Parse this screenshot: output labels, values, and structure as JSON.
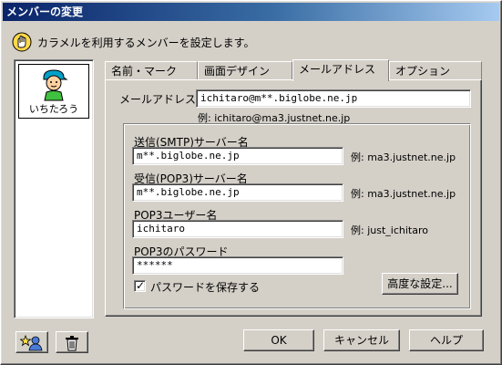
{
  "window": {
    "title": "メンバーの変更"
  },
  "intro": {
    "text": "カラメルを利用するメンバーを設定します。"
  },
  "members": [
    {
      "name": "いちたろう"
    }
  ],
  "tabs": [
    {
      "label": "名前・マーク"
    },
    {
      "label": "画面デザイン"
    },
    {
      "label": "メールアドレス",
      "active": true
    },
    {
      "label": "オプション"
    }
  ],
  "mail": {
    "address_label": "メールアドレス",
    "address_value": "ichitaro@m**.biglobe.ne.jp",
    "address_example": "例: ichitaro@ma3.justnet.ne.jp",
    "smtp_label": "送信(SMTP)サーバー名",
    "smtp_value": "m**.biglobe.ne.jp",
    "smtp_example": "例: ma3.justnet.ne.jp",
    "pop3_label": "受信(POP3)サーバー名",
    "pop3_value": "m**.biglobe.ne.jp",
    "pop3_example": "例: ma3.justnet.ne.jp",
    "user_label": "POP3ユーザー名",
    "user_value": "ichitaro",
    "user_example": "例: just_ichitaro",
    "password_label": "POP3のパスワード",
    "password_value": "******",
    "save_password_label": "パスワードを保存する",
    "save_password_checked": true,
    "advanced_button": "高度な設定..."
  },
  "footer": {
    "ok": "OK",
    "cancel": "キャンセル",
    "help": "ヘルプ"
  },
  "icons": {
    "title_hand": "hand-icon",
    "add_member": "add-member-icon",
    "delete": "trash-icon"
  }
}
